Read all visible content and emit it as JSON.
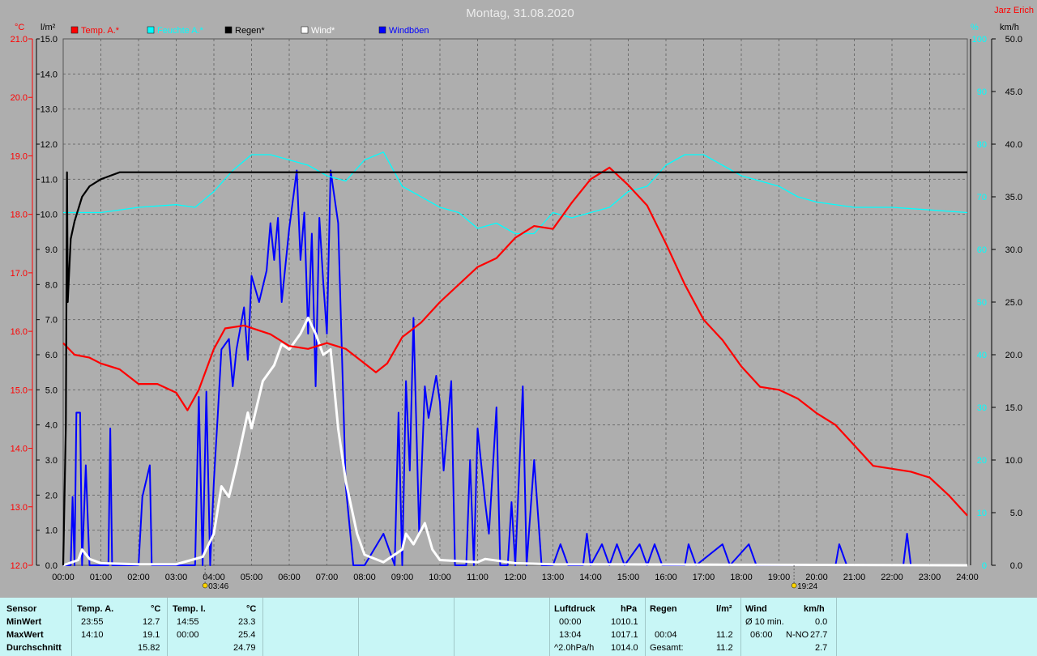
{
  "title": "Montag, 31.08.2020",
  "author": "Jarz Erich",
  "axis_units": {
    "temp": "°C",
    "rain": "l/m²",
    "humidity": "%",
    "wind": "km/h"
  },
  "legend": [
    {
      "label": "Temp. A.*",
      "color": "#ff0000"
    },
    {
      "label": "Feuchte A.*",
      "color": "#00ffff"
    },
    {
      "label": "Regen*",
      "color": "#000000"
    },
    {
      "label": "Wind*",
      "color": "#ffffff"
    },
    {
      "label": "Windböen",
      "color": "#0000ff"
    }
  ],
  "sun_markers": {
    "sunrise": "03:46",
    "sunset": "19:24"
  },
  "chart_data": {
    "type": "line",
    "title": "Montag, 31.08.2020",
    "xlabel": "",
    "x_ticks": [
      "00:00",
      "01:00",
      "02:00",
      "03:00",
      "04:00",
      "05:00",
      "06:00",
      "07:00",
      "08:00",
      "09:00",
      "10:00",
      "11:00",
      "12:00",
      "13:00",
      "14:00",
      "15:00",
      "16:00",
      "17:00",
      "18:00",
      "19:00",
      "20:00",
      "21:00",
      "22:00",
      "23:00",
      "24:00"
    ],
    "x_range_hours": [
      0,
      24
    ],
    "y_axes": {
      "temp": {
        "unit": "°C",
        "range": [
          12.0,
          21.0
        ],
        "ticks": [
          "12.0",
          "13.0",
          "14.0",
          "15.0",
          "16.0",
          "17.0",
          "18.0",
          "19.0",
          "20.0",
          "21.0"
        ]
      },
      "rain": {
        "unit": "l/m²",
        "range": [
          0.0,
          15.0
        ],
        "ticks": [
          "0.0",
          "1.0",
          "2.0",
          "3.0",
          "4.0",
          "5.0",
          "6.0",
          "7.0",
          "8.0",
          "9.0",
          "10.0",
          "11.0",
          "12.0",
          "13.0",
          "14.0",
          "15.0"
        ]
      },
      "humidity": {
        "unit": "%",
        "range": [
          0,
          100
        ],
        "ticks": [
          "0",
          "10",
          "20",
          "30",
          "40",
          "50",
          "60",
          "70",
          "80",
          "90",
          "100"
        ]
      },
      "wind": {
        "unit": "km/h",
        "range": [
          0.0,
          50.0
        ],
        "ticks": [
          "0.0",
          "5.0",
          "10.0",
          "15.0",
          "20.0",
          "25.0",
          "30.0",
          "35.0",
          "40.0",
          "45.0",
          "50.0"
        ]
      }
    },
    "grid": true,
    "legend_position": "top",
    "series": [
      {
        "name": "Temp. A.*",
        "axis": "temp",
        "color": "#ff0000",
        "points": [
          [
            0,
            15.8
          ],
          [
            0.3,
            15.6
          ],
          [
            0.7,
            15.55
          ],
          [
            1.0,
            15.45
          ],
          [
            1.5,
            15.35
          ],
          [
            2.0,
            15.1
          ],
          [
            2.5,
            15.1
          ],
          [
            3.0,
            14.95
          ],
          [
            3.3,
            14.65
          ],
          [
            3.6,
            15.0
          ],
          [
            4.0,
            15.7
          ],
          [
            4.3,
            16.05
          ],
          [
            4.8,
            16.1
          ],
          [
            5.5,
            15.95
          ],
          [
            6.0,
            15.75
          ],
          [
            6.5,
            15.7
          ],
          [
            7.0,
            15.8
          ],
          [
            7.5,
            15.7
          ],
          [
            8.0,
            15.45
          ],
          [
            8.3,
            15.3
          ],
          [
            8.6,
            15.45
          ],
          [
            9.0,
            15.9
          ],
          [
            9.5,
            16.15
          ],
          [
            10.0,
            16.5
          ],
          [
            10.5,
            16.8
          ],
          [
            11.0,
            17.1
          ],
          [
            11.5,
            17.25
          ],
          [
            12.0,
            17.6
          ],
          [
            12.5,
            17.8
          ],
          [
            13.0,
            17.75
          ],
          [
            13.5,
            18.2
          ],
          [
            14.0,
            18.6
          ],
          [
            14.5,
            18.8
          ],
          [
            15.0,
            18.5
          ],
          [
            15.5,
            18.15
          ],
          [
            16.0,
            17.5
          ],
          [
            16.5,
            16.8
          ],
          [
            17.0,
            16.2
          ],
          [
            17.5,
            15.85
          ],
          [
            18.0,
            15.4
          ],
          [
            18.5,
            15.05
          ],
          [
            19.0,
            15.0
          ],
          [
            19.5,
            14.85
          ],
          [
            20.0,
            14.6
          ],
          [
            20.5,
            14.4
          ],
          [
            21.0,
            14.05
          ],
          [
            21.5,
            13.7
          ],
          [
            22.0,
            13.65
          ],
          [
            22.5,
            13.6
          ],
          [
            23.0,
            13.5
          ],
          [
            23.5,
            13.2
          ],
          [
            24.0,
            12.85
          ]
        ]
      },
      {
        "name": "Feuchte A.*",
        "axis": "humidity",
        "color": "#00ffff",
        "points": [
          [
            0,
            67
          ],
          [
            1.0,
            67
          ],
          [
            2.0,
            68
          ],
          [
            3.0,
            68.5
          ],
          [
            3.5,
            68
          ],
          [
            4.0,
            71
          ],
          [
            4.5,
            75
          ],
          [
            5.0,
            78
          ],
          [
            5.5,
            78
          ],
          [
            6.0,
            77
          ],
          [
            6.5,
            76
          ],
          [
            7.0,
            74
          ],
          [
            7.5,
            73
          ],
          [
            8.0,
            77
          ],
          [
            8.5,
            78.5
          ],
          [
            9.0,
            72
          ],
          [
            10.0,
            68
          ],
          [
            10.5,
            67
          ],
          [
            11.0,
            64
          ],
          [
            11.5,
            65
          ],
          [
            12.0,
            63
          ],
          [
            12.5,
            63
          ],
          [
            13.0,
            67
          ],
          [
            13.5,
            66
          ],
          [
            14.0,
            67
          ],
          [
            14.5,
            68
          ],
          [
            15.0,
            71
          ],
          [
            15.5,
            72
          ],
          [
            16.0,
            76
          ],
          [
            16.5,
            78
          ],
          [
            17.0,
            78
          ],
          [
            17.5,
            76
          ],
          [
            18.0,
            74
          ],
          [
            18.5,
            73
          ],
          [
            19.0,
            72
          ],
          [
            19.5,
            70
          ],
          [
            20.0,
            69
          ],
          [
            21.0,
            68
          ],
          [
            22.0,
            68
          ],
          [
            23.0,
            67.5
          ],
          [
            24.0,
            67
          ]
        ]
      },
      {
        "name": "Regen*",
        "axis": "rain",
        "color": "#000000",
        "points": [
          [
            0,
            0
          ],
          [
            0.07,
            4.0
          ],
          [
            0.1,
            11.2
          ],
          [
            0.12,
            7.5
          ],
          [
            0.2,
            9.3
          ],
          [
            0.3,
            9.8
          ],
          [
            0.5,
            10.5
          ],
          [
            0.7,
            10.8
          ],
          [
            1.0,
            11.0
          ],
          [
            1.5,
            11.2
          ],
          [
            2.0,
            11.2
          ],
          [
            24.0,
            11.2
          ]
        ]
      },
      {
        "name": "Wind*",
        "axis": "wind",
        "color": "#ffffff",
        "points": [
          [
            0,
            0
          ],
          [
            0.4,
            0.5
          ],
          [
            0.5,
            1.5
          ],
          [
            0.7,
            0.6
          ],
          [
            1.0,
            0.2
          ],
          [
            2.0,
            0.1
          ],
          [
            3.0,
            0.1
          ],
          [
            3.4,
            0.5
          ],
          [
            3.7,
            0.8
          ],
          [
            4.0,
            3.0
          ],
          [
            4.2,
            7.5
          ],
          [
            4.4,
            6.5
          ],
          [
            4.6,
            9.5
          ],
          [
            4.9,
            14.5
          ],
          [
            5.0,
            13.0
          ],
          [
            5.3,
            17.5
          ],
          [
            5.6,
            19.0
          ],
          [
            5.8,
            21.0
          ],
          [
            6.0,
            20.5
          ],
          [
            6.3,
            22.0
          ],
          [
            6.5,
            23.5
          ],
          [
            6.7,
            22.0
          ],
          [
            6.9,
            20.0
          ],
          [
            7.1,
            20.5
          ],
          [
            7.3,
            13.0
          ],
          [
            7.5,
            8.0
          ],
          [
            7.8,
            3.0
          ],
          [
            8.0,
            1.0
          ],
          [
            8.5,
            0.3
          ],
          [
            9.0,
            1.5
          ],
          [
            9.1,
            3.0
          ],
          [
            9.3,
            2.0
          ],
          [
            9.6,
            4.0
          ],
          [
            9.8,
            1.5
          ],
          [
            10.0,
            0.5
          ],
          [
            11.0,
            0.3
          ],
          [
            11.2,
            0.6
          ],
          [
            12.0,
            0.2
          ],
          [
            13.0,
            0.1
          ],
          [
            24.0,
            0.0
          ]
        ]
      },
      {
        "name": "Windböen",
        "axis": "wind",
        "color": "#0000ff",
        "points": [
          [
            0,
            0
          ],
          [
            0.2,
            0
          ],
          [
            0.25,
            6.5
          ],
          [
            0.3,
            0
          ],
          [
            0.35,
            14.5
          ],
          [
            0.45,
            14.5
          ],
          [
            0.5,
            0
          ],
          [
            0.6,
            9.5
          ],
          [
            0.7,
            0
          ],
          [
            1.2,
            0
          ],
          [
            1.25,
            13.0
          ],
          [
            1.3,
            0
          ],
          [
            2.0,
            0
          ],
          [
            2.1,
            6.5
          ],
          [
            2.3,
            9.5
          ],
          [
            2.35,
            0
          ],
          [
            3.5,
            0
          ],
          [
            3.6,
            16.0
          ],
          [
            3.7,
            0
          ],
          [
            3.8,
            16.5
          ],
          [
            3.9,
            0
          ],
          [
            4.0,
            8.0
          ],
          [
            4.1,
            14.0
          ],
          [
            4.2,
            20.5
          ],
          [
            4.4,
            21.5
          ],
          [
            4.5,
            17.0
          ],
          [
            4.6,
            20.5
          ],
          [
            4.8,
            24.5
          ],
          [
            4.9,
            19.5
          ],
          [
            5.0,
            27.5
          ],
          [
            5.2,
            25.0
          ],
          [
            5.4,
            28.0
          ],
          [
            5.5,
            32.5
          ],
          [
            5.6,
            29.0
          ],
          [
            5.7,
            33.0
          ],
          [
            5.8,
            25.0
          ],
          [
            6.0,
            32.0
          ],
          [
            6.2,
            37.5
          ],
          [
            6.3,
            29.0
          ],
          [
            6.4,
            33.5
          ],
          [
            6.5,
            22.0
          ],
          [
            6.6,
            31.5
          ],
          [
            6.7,
            17.0
          ],
          [
            6.8,
            33.0
          ],
          [
            6.9,
            27.0
          ],
          [
            7.0,
            22.0
          ],
          [
            7.1,
            37.5
          ],
          [
            7.3,
            32.5
          ],
          [
            7.5,
            7.5
          ],
          [
            7.7,
            0
          ],
          [
            8.0,
            0
          ],
          [
            8.5,
            3.0
          ],
          [
            8.8,
            0
          ],
          [
            8.9,
            14.5
          ],
          [
            9.0,
            0
          ],
          [
            9.1,
            17.5
          ],
          [
            9.2,
            9.0
          ],
          [
            9.3,
            23.5
          ],
          [
            9.45,
            3.0
          ],
          [
            9.6,
            17.0
          ],
          [
            9.7,
            14.0
          ],
          [
            9.9,
            18.0
          ],
          [
            10.0,
            15.5
          ],
          [
            10.1,
            9.0
          ],
          [
            10.3,
            17.5
          ],
          [
            10.4,
            0
          ],
          [
            10.7,
            0
          ],
          [
            10.8,
            10.0
          ],
          [
            10.9,
            0
          ],
          [
            11.0,
            13.0
          ],
          [
            11.2,
            6.0
          ],
          [
            11.3,
            3.0
          ],
          [
            11.5,
            15.0
          ],
          [
            11.6,
            0
          ],
          [
            11.8,
            0
          ],
          [
            11.9,
            6.0
          ],
          [
            12.0,
            0
          ],
          [
            12.2,
            17.0
          ],
          [
            12.3,
            0
          ],
          [
            12.5,
            10.0
          ],
          [
            12.6,
            5.0
          ],
          [
            12.7,
            0
          ],
          [
            13.0,
            0
          ],
          [
            13.2,
            2.0
          ],
          [
            13.4,
            0
          ],
          [
            13.8,
            0
          ],
          [
            13.9,
            3.0
          ],
          [
            14.0,
            0
          ],
          [
            14.3,
            2.0
          ],
          [
            14.5,
            0
          ],
          [
            14.7,
            2.0
          ],
          [
            14.9,
            0
          ],
          [
            15.3,
            2.0
          ],
          [
            15.5,
            0
          ],
          [
            15.7,
            2.0
          ],
          [
            15.9,
            0
          ],
          [
            16.5,
            0
          ],
          [
            16.6,
            2.0
          ],
          [
            16.8,
            0
          ],
          [
            17.5,
            2.0
          ],
          [
            17.7,
            0
          ],
          [
            18.2,
            2.0
          ],
          [
            18.4,
            0
          ],
          [
            20.5,
            0
          ],
          [
            20.6,
            2.0
          ],
          [
            20.8,
            0
          ],
          [
            22.3,
            0
          ],
          [
            22.4,
            3.0
          ],
          [
            22.5,
            0
          ],
          [
            24.0,
            0
          ]
        ]
      }
    ]
  },
  "stats": {
    "sensor": {
      "header": "Sensor",
      "rows": [
        "MinWert",
        "MaxWert",
        "Durchschnitt"
      ]
    },
    "temp_a": {
      "header": "Temp. A.",
      "unit": "°C",
      "min_time": "23:55",
      "min": "12.7",
      "max_time": "14:10",
      "max": "19.1",
      "avg": "15.82"
    },
    "temp_i": {
      "header": "Temp. I.",
      "unit": "°C",
      "min_time": "14:55",
      "min": "23.3",
      "max_time": "00:00",
      "max": "25.4",
      "avg": "24.79"
    },
    "pressure": {
      "header": "Luftdruck",
      "unit": "hPa",
      "t1": "00:00",
      "v1": "1010.1",
      "t2": "13:04",
      "v2": "1017.1",
      "t3": "^2.0hPa/h",
      "v3": "1014.0"
    },
    "rain": {
      "header": "Regen",
      "unit": "l/m²",
      "t2": "00:04",
      "v2": "11.2",
      "t3": "Gesamt:",
      "v3": "11.2"
    },
    "wind": {
      "header": "Wind",
      "unit": "km/h",
      "l1": "Ø 10 min.",
      "v1": "0.0",
      "l2": "06:00",
      "d2": "N-NO",
      "v2": "27.7",
      "v3": "2.7"
    }
  }
}
